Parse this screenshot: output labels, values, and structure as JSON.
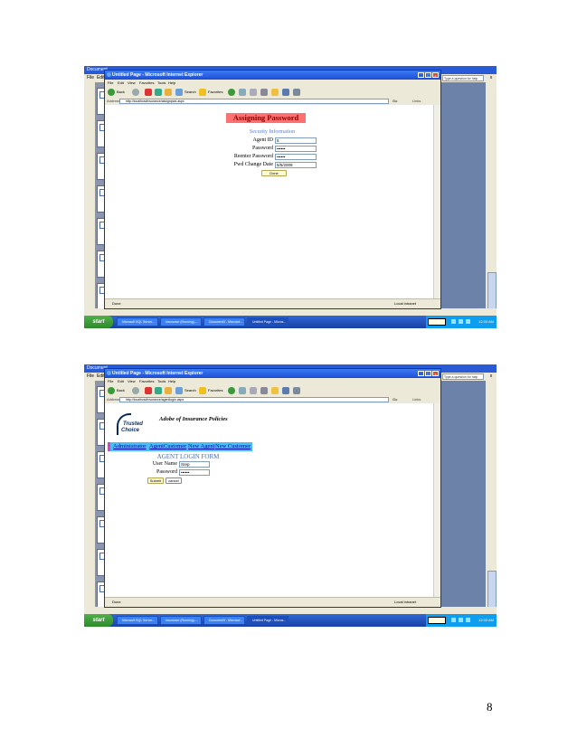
{
  "word": {
    "title": "Document",
    "menu": [
      "File",
      "Edit"
    ],
    "help_placeholder": "Type a question for help",
    "close": "x"
  },
  "ie": {
    "title": "Untitled Page - Microsoft Internet Explorer",
    "menu": [
      "File",
      "Edit",
      "View",
      "Favorites",
      "Tools",
      "Help"
    ],
    "toolbar": {
      "back": "Back",
      "search": "Search",
      "favorites": "Favorites"
    },
    "address_label": "Address",
    "go": "Go",
    "links": "Links",
    "status_left": "Done",
    "status_right": "Local intranet"
  },
  "taskbar": {
    "start": "start",
    "tasks": [
      "Microsoft SQL Server...",
      "Insurance (Running)-...",
      "Document3 - Microsof...",
      "Untitled Page - Micros..."
    ],
    "clock": "12:33 AM"
  },
  "page1": {
    "url": "http://localhost/insurance/assignpwd.aspx",
    "heading": "Assigning Password",
    "section": "Security Information",
    "labels": {
      "agent_id": "Agent ID",
      "password": "Password",
      "reenter": "Reenter Password",
      "pwd_change_date": "Pwd Change Date"
    },
    "values": {
      "agent_id": "5",
      "password": "••••••",
      "reenter": "••••••",
      "pwd_change_date": "5/5/2009"
    },
    "done_button": "Done"
  },
  "page2": {
    "url": "http://localhost/insurance/agentlogin.aspx",
    "logo_line1": "Trusted",
    "logo_line2": "Choice",
    "site_title": "Adobe of Insurance Policies",
    "nav": [
      "Administrator",
      "Agent",
      "Customer",
      "New Agent",
      "New Customer"
    ],
    "form_title": "AGENT LOGIN FORM",
    "labels": {
      "user_name": "User Name",
      "password": "Password"
    },
    "values": {
      "user_name": "Srep",
      "password": "••••••"
    },
    "submit": "Submit",
    "cancel": "cancel"
  },
  "page_number": "8"
}
